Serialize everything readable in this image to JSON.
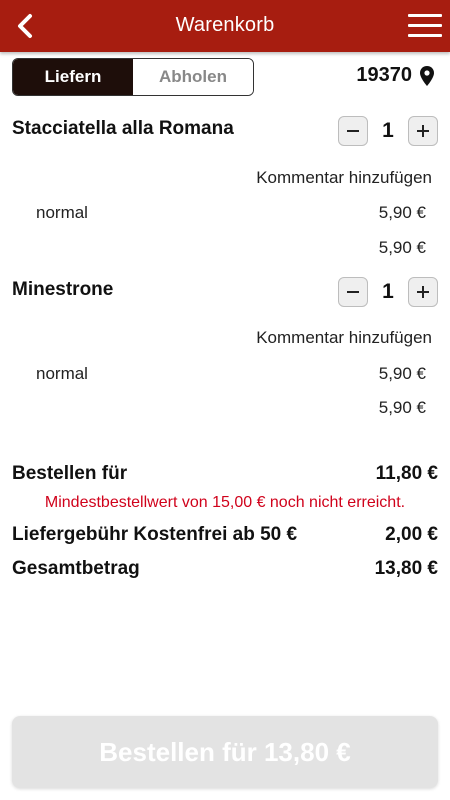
{
  "header": {
    "title": "Warenkorb",
    "back_icon": "chevron-left-icon",
    "menu_icon": "hamburger-menu-icon",
    "color": "#a71d10"
  },
  "delivery_toggle": {
    "deliver": "Liefern",
    "pickup": "Abholen",
    "selected": "Liefern"
  },
  "location": {
    "zip": "19370",
    "icon": "location-pin-icon"
  },
  "items": [
    {
      "name": "Stacciatella alla Romana",
      "quantity": "1",
      "comment_link": "Kommentar hinzufügen",
      "variant": "normal",
      "variant_price": "5,90 €",
      "line_total": "5,90 €"
    },
    {
      "name": "Minestrone",
      "quantity": "1",
      "comment_link": "Kommentar hinzufügen",
      "variant": "normal",
      "variant_price": "5,90 €",
      "line_total": "5,90 €"
    }
  ],
  "summary": {
    "order_for_label": "Bestellen für",
    "order_for_value": "11,80 €",
    "minimum_warning": "Mindestbestellwert von 15,00 € noch nicht erreicht.",
    "delivery_fee_label": "Liefergebühr Kostenfrei ab 50 €",
    "delivery_fee_value": "2,00 €",
    "total_label": "Gesamtbetrag",
    "total_value": "13,80 €"
  },
  "order_button": {
    "label": "Bestellen für 13,80 €",
    "enabled": false
  },
  "colors": {
    "warning": "#d0021b",
    "toggle_active": "#1e0e0a"
  }
}
